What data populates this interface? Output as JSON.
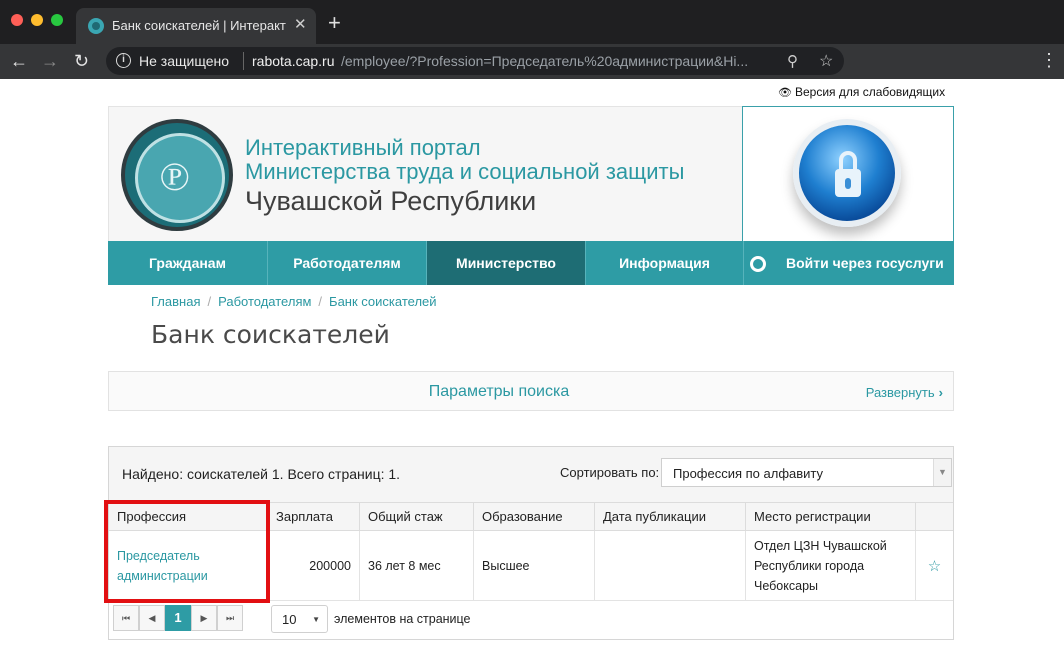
{
  "browser": {
    "tab_title": "Банк соискателей | Интеракт",
    "tab_close": "✕",
    "new_tab": "+",
    "not_secure": "Не защищено",
    "url_host": "rabota.cap.ru",
    "url_path": "/employee/?Profession=Председатель%20администрации&Hi..."
  },
  "page": {
    "low_vision": "Версия для слабовидящих",
    "portal": {
      "line1": "Интерактивный портал",
      "line2": "Министерства труда и социальной защиты",
      "line3": "Чувашской Республики"
    },
    "nav": {
      "items": [
        {
          "label": "Гражданам"
        },
        {
          "label": "Работодателям"
        },
        {
          "label": "Министерство"
        },
        {
          "label": "Информация"
        }
      ],
      "gos_login": "Войти через госуслуги"
    },
    "breadcrumb": [
      "Главная",
      "Работодателям",
      "Банк соискателей"
    ],
    "title": "Банк соискателей",
    "search_panel": {
      "title": "Параметры поиска",
      "expand": "Развернуть"
    },
    "grid": {
      "found": "Найдено: соискателей 1. Всего страниц: 1.",
      "sort_label": "Сортировать по:",
      "sort_value": "Профессия по алфавиту",
      "columns": [
        "Профессия",
        "Зарплата",
        "Общий стаж",
        "Образование",
        "Дата публикации",
        "Место регистрации",
        ""
      ],
      "rows": [
        {
          "profession": "Председатель администрации",
          "salary": "200000",
          "experience": "36 лет 8 мес",
          "education": "Высшее",
          "published": "",
          "registration": "Отдел ЦЗН Чувашской Республики города Чебоксары"
        }
      ],
      "pager": {
        "current_page": "1",
        "page_size": "10",
        "page_size_label": "элементов на странице"
      }
    }
  },
  "colors": {
    "accent": "#2e9ca5",
    "nav_active": "#1e6d74",
    "highlight": "#e20f12"
  }
}
